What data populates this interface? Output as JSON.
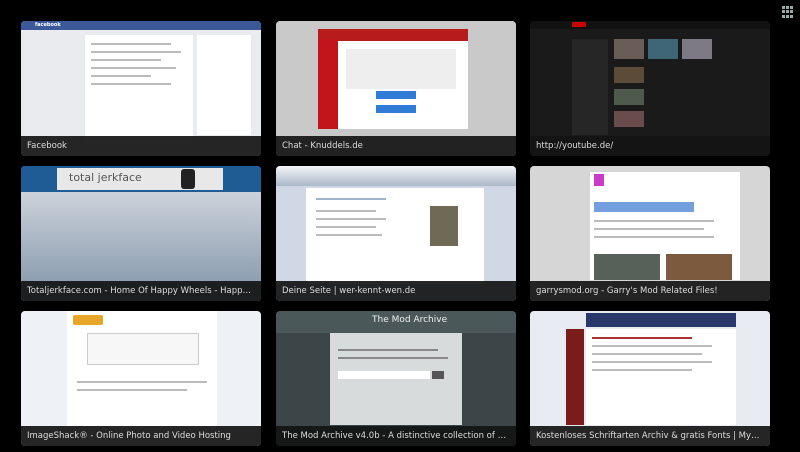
{
  "tiles": [
    {
      "title": "Facebook",
      "logo": "facebook"
    },
    {
      "title": "Chat - Knuddels.de"
    },
    {
      "title": "http://youtube.de/"
    },
    {
      "title": "Totaljerkface.com - Home Of Happy Wheels - Happy Wheels ...",
      "logo": "total jerkface"
    },
    {
      "title": "Deine Seite | wer-kennt-wen.de"
    },
    {
      "title": "garrysmod.org - Garry's Mod Related Files!"
    },
    {
      "title": "ImageShack® - Online Photo and Video Hosting"
    },
    {
      "title": "The Mod Archive v4.0b - A distinctive collection of modules",
      "logo": "The Mod Archive"
    },
    {
      "title": "Kostenloses Schriftarten Archiv & gratis Fonts | MyFont.de"
    }
  ],
  "controls": {
    "grid_icon": "grid-icon"
  }
}
